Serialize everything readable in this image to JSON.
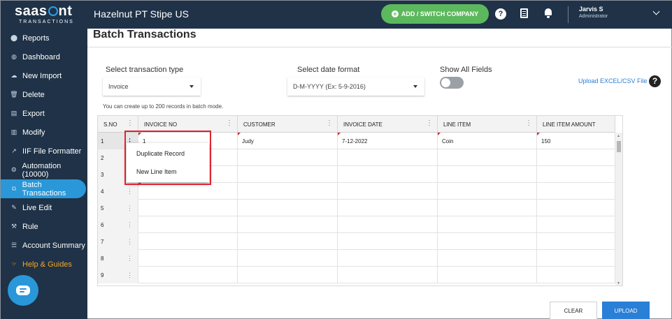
{
  "brand": {
    "logo_text": "saasant",
    "logo_sub": "TRANSACTIONS",
    "accent": "#2a97d8"
  },
  "sidebar": {
    "items": [
      {
        "label": "Reports",
        "icon": "reports-icon",
        "glyph": "⬤"
      },
      {
        "label": "Dashboard",
        "icon": "dashboard-icon",
        "glyph": "◍"
      },
      {
        "label": "New Import",
        "icon": "cloud-upload-icon",
        "glyph": "☁"
      },
      {
        "label": "Delete",
        "icon": "trash-icon",
        "glyph": "🗑"
      },
      {
        "label": "Export",
        "icon": "export-icon",
        "glyph": "▤"
      },
      {
        "label": "Modify",
        "icon": "modify-icon",
        "glyph": "▥"
      },
      {
        "label": "IIF File Formatter",
        "icon": "external-link-icon",
        "glyph": "↗"
      },
      {
        "label": "Automation (10000)",
        "icon": "gears-icon",
        "glyph": "⚙"
      },
      {
        "label": "Batch Transactions",
        "icon": "batch-icon",
        "glyph": "⧉"
      },
      {
        "label": "Live Edit",
        "icon": "pencil-icon",
        "glyph": "✎"
      },
      {
        "label": "Rule",
        "icon": "gavel-icon",
        "glyph": "⚒"
      },
      {
        "label": "Account Summary",
        "icon": "list-icon",
        "glyph": "☰"
      },
      {
        "label": "Help & Guides",
        "icon": "hand-pointer-icon",
        "glyph": "☞"
      }
    ],
    "active": "Batch Transactions"
  },
  "topbar": {
    "company": "Hazelnut PT Stipe US",
    "add_company_label": "ADD / SWITCH COMPANY",
    "help_glyph": "?",
    "user_name": "Jarvis S",
    "user_role": "Administrator"
  },
  "page": {
    "title": "Batch Transactions",
    "transaction_type_label": "Select transaction type",
    "transaction_type_value": "Invoice",
    "date_format_label": "Select date format",
    "date_format_value": "D-M-YYYY (Ex: 5-9-2016)",
    "show_all_label": "Show All Fields",
    "show_all_on": false,
    "upload_link": "Upload EXCEL/CSV File",
    "help_glyph": "?",
    "note": "You can create up to 200 records in batch mode."
  },
  "grid": {
    "columns": [
      "S.NO",
      "INVOICE NO",
      "CUSTOMER",
      "INVOICE DATE",
      "LINE ITEM",
      "LINE ITEM AMOUNT"
    ],
    "rows": [
      {
        "sno": "1",
        "invoice_no": "1",
        "customer": "Judy",
        "invoice_date": "7-12-2022",
        "line_item": "Coin",
        "amount": "150"
      },
      {
        "sno": "2",
        "invoice_no": "",
        "customer": "",
        "invoice_date": "",
        "line_item": "",
        "amount": ""
      },
      {
        "sno": "3",
        "invoice_no": "",
        "customer": "",
        "invoice_date": "",
        "line_item": "",
        "amount": ""
      },
      {
        "sno": "4",
        "invoice_no": "",
        "customer": "",
        "invoice_date": "",
        "line_item": "",
        "amount": ""
      },
      {
        "sno": "5",
        "invoice_no": "",
        "customer": "",
        "invoice_date": "",
        "line_item": "",
        "amount": ""
      },
      {
        "sno": "6",
        "invoice_no": "",
        "customer": "",
        "invoice_date": "",
        "line_item": "",
        "amount": ""
      },
      {
        "sno": "7",
        "invoice_no": "",
        "customer": "",
        "invoice_date": "",
        "line_item": "",
        "amount": ""
      },
      {
        "sno": "8",
        "invoice_no": "",
        "customer": "",
        "invoice_date": "",
        "line_item": "",
        "amount": ""
      },
      {
        "sno": "9",
        "invoice_no": "",
        "customer": "",
        "invoice_date": "",
        "line_item": "",
        "amount": ""
      }
    ]
  },
  "context_menu": {
    "items": [
      "Duplicate Record",
      "New Line Item"
    ]
  },
  "buttons": {
    "clear": "CLEAR",
    "upload": "UPLOAD"
  },
  "colors": {
    "sidebar_bg": "#1f3247",
    "active_item": "#2a97d8",
    "add_company": "#5cb85c",
    "highlight_box": "#e0232f",
    "primary_button": "#2a7fd6"
  }
}
